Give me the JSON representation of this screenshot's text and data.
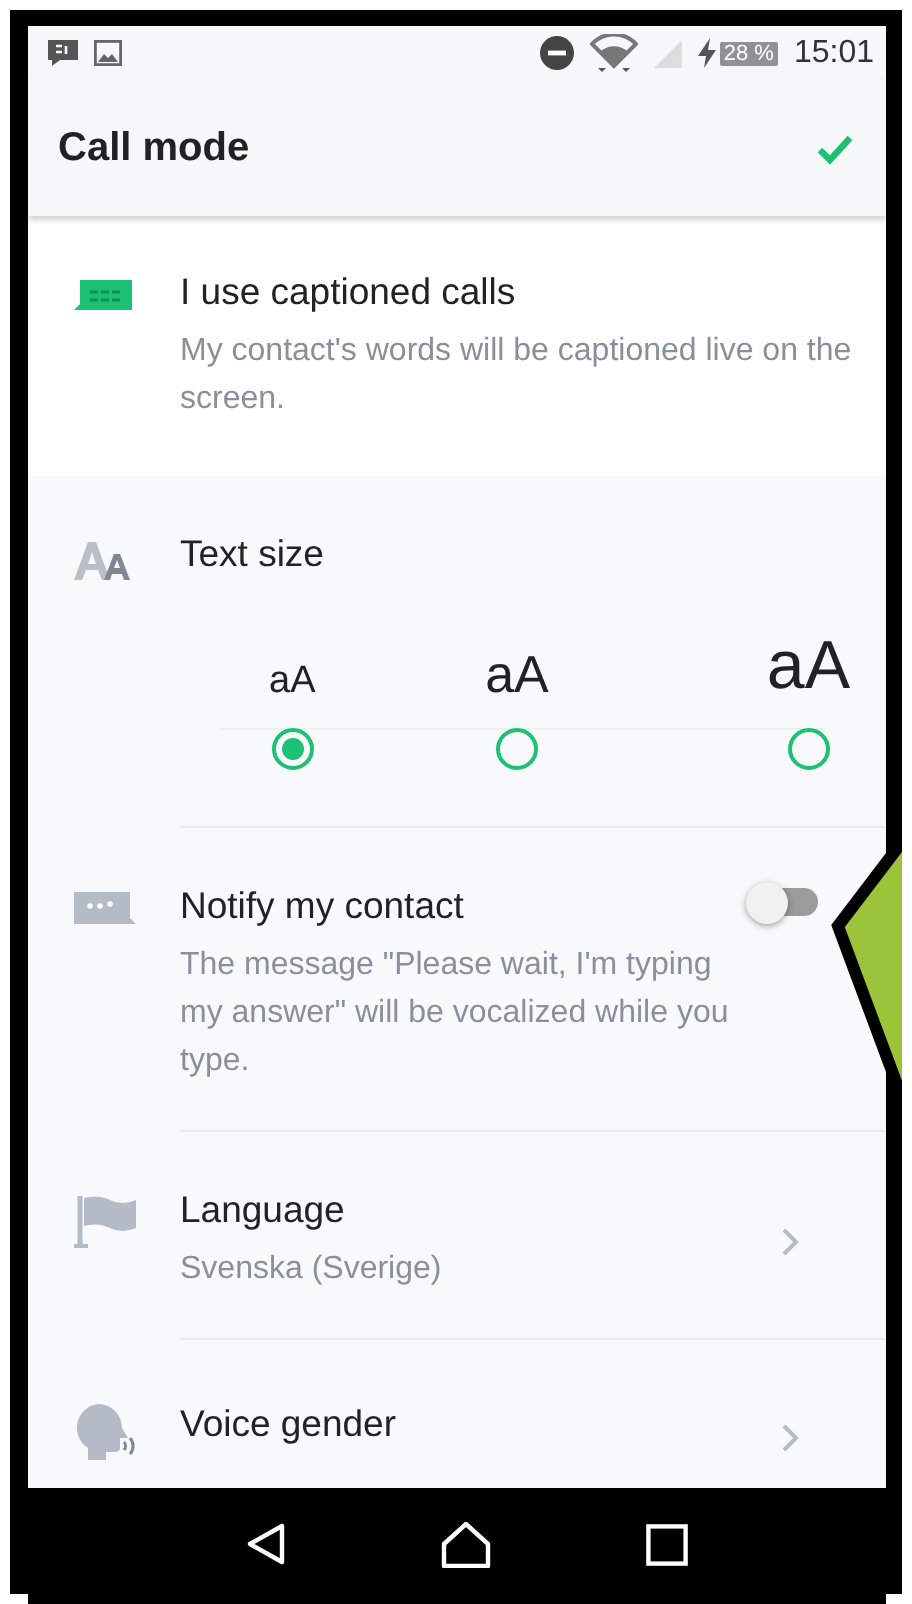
{
  "status_bar": {
    "battery": "28 %",
    "time": "15:01"
  },
  "header": {
    "title": "Call mode"
  },
  "caption_option": {
    "title": "I use captioned calls",
    "description": "My contact's words will be captioned live on the screen."
  },
  "text_size": {
    "title": "Text size",
    "options": [
      {
        "label": "aA",
        "kind": "small",
        "selected": true
      },
      {
        "label": "aA",
        "kind": "medium",
        "selected": false
      },
      {
        "label": "aA",
        "kind": "large",
        "selected": false
      }
    ]
  },
  "notify": {
    "title": "Notify my contact",
    "description": "The message \"Please wait, I'm typing my answer\" will be vocalized while you type.",
    "on": false
  },
  "language": {
    "title": "Language",
    "value": "Svenska (Sverige)"
  },
  "voice_gender": {
    "title": "Voice gender"
  }
}
